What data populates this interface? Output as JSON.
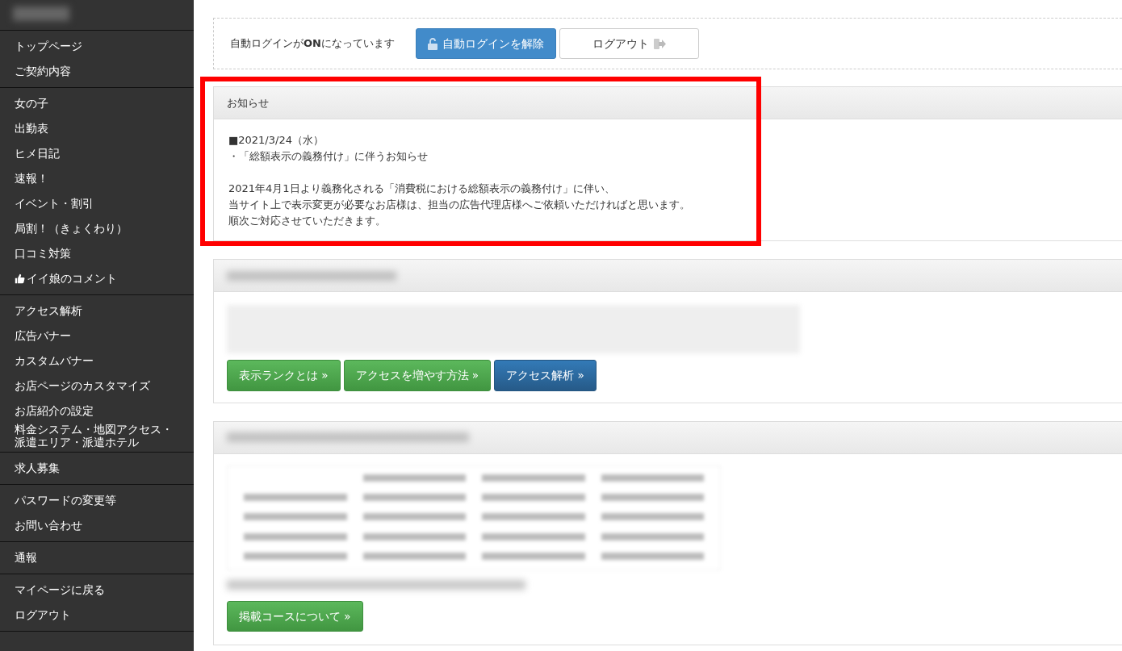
{
  "sidebar": {
    "groups": [
      {
        "items": [
          {
            "label": "トップページ"
          },
          {
            "label": "ご契約内容"
          }
        ]
      },
      {
        "items": [
          {
            "label": "女の子"
          },
          {
            "label": "出勤表"
          },
          {
            "label": "ヒメ日記"
          },
          {
            "label": "速報！"
          },
          {
            "label": "イベント・割引"
          },
          {
            "label": "局割！（きょくわり）"
          },
          {
            "label": "口コミ対策"
          },
          {
            "label": "イイ娘のコメント",
            "kind": "liked"
          }
        ]
      },
      {
        "items": [
          {
            "label": "アクセス解析"
          },
          {
            "label": "広告バナー"
          },
          {
            "label": "カスタムバナー"
          },
          {
            "label": "お店ページのカスタマイズ"
          },
          {
            "label": "お店紹介の設定"
          },
          {
            "label": "料金システム・地図アクセス・派遣エリア・派遣ホテル"
          }
        ]
      },
      {
        "items": [
          {
            "label": "求人募集"
          }
        ]
      },
      {
        "items": [
          {
            "label": "パスワードの変更等"
          },
          {
            "label": "お問い合わせ"
          }
        ]
      },
      {
        "items": [
          {
            "label": "通報"
          }
        ]
      },
      {
        "items": [
          {
            "label": "マイページに戻る"
          },
          {
            "label": "ログアウト"
          }
        ]
      }
    ]
  },
  "login_bar": {
    "status": "自動ログインが**ON**になっています",
    "buttons": [
      {
        "label": "自動ログインを解除",
        "kind": "primary"
      },
      {
        "label": "ログアウト",
        "kind": "default"
      }
    ]
  },
  "notice": {
    "title": "お知らせ",
    "highlighted": true,
    "paragraphs": [
      [
        "■2021/3/24（水）",
        "・「総額表示の義務付け」に伴うお知らせ"
      ],
      [
        "2021年4月1日より義務化される「消費税における総額表示の義務付け」に伴い、",
        "当サイト上で表示変更が必要なお店様は、担当の広告代理店様へご依頼いただければと思います。",
        "順次ご対応させていただきます。"
      ]
    ]
  },
  "rank_panel": {
    "buttons": [
      {
        "label": "表示ランクとは »",
        "kind": "success"
      },
      {
        "label": "アクセスを増やす方法 »",
        "kind": "success"
      },
      {
        "label": "アクセス解析 »",
        "kind": "primary"
      }
    ]
  },
  "course_panel": {
    "buttons": [
      {
        "label": "掲載コースについて »",
        "kind": "success"
      }
    ]
  }
}
